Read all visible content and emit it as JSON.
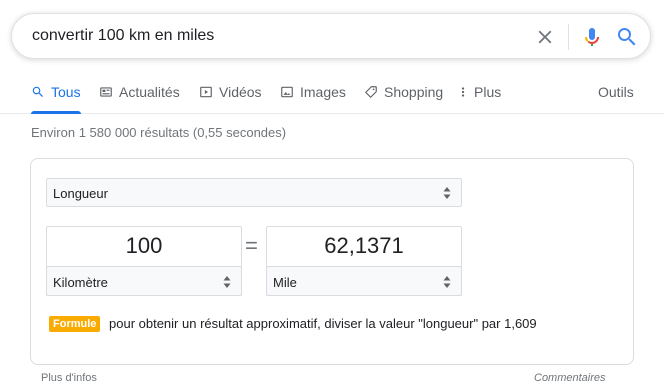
{
  "search": {
    "query": "convertir 100 km en miles"
  },
  "tabs": [
    {
      "label": "Tous",
      "icon": "search-icon",
      "active": true
    },
    {
      "label": "Actualités",
      "icon": "news-icon"
    },
    {
      "label": "Vidéos",
      "icon": "video-icon"
    },
    {
      "label": "Images",
      "icon": "image-icon"
    },
    {
      "label": "Shopping",
      "icon": "tag-icon"
    },
    {
      "label": "Plus",
      "icon": "more-vert-icon"
    }
  ],
  "tools_label": "Outils",
  "stats": "Environ 1 580 000 résultats (0,55 secondes)",
  "converter": {
    "type_label": "Longueur",
    "from_value": "100",
    "from_unit": "Kilomètre",
    "equals": "=",
    "to_value": "62,1371",
    "to_unit": "Mile",
    "formula_label": "Formule",
    "formula_text": "pour obtenir un résultat approximatif, diviser la valeur \"longueur\" par 1,609"
  },
  "footer": {
    "more_info": "Plus d'infos",
    "feedback": "Commentaires"
  },
  "colors": {
    "accent": "#1a73e8",
    "formula_badge": "#f9ab00"
  }
}
